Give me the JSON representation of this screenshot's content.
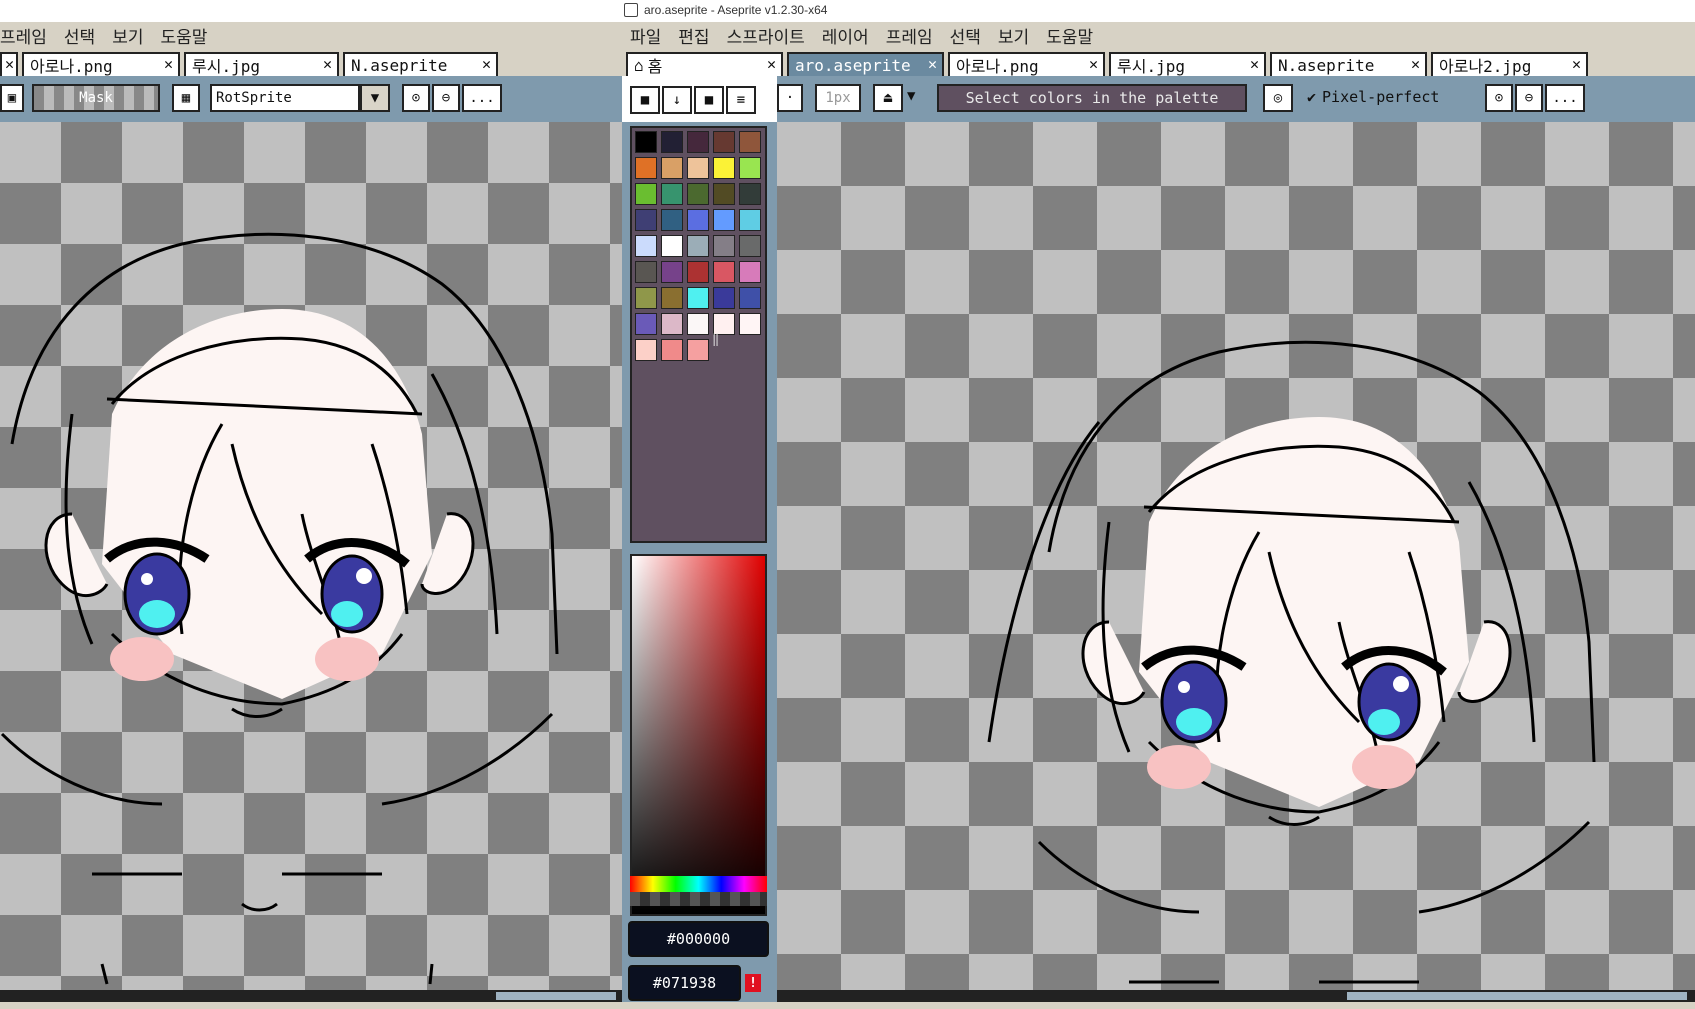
{
  "window": {
    "title": "aro.aseprite - Aseprite v1.2.30-x64"
  },
  "left_window": {
    "menu": [
      "프레임",
      "선택",
      "보기",
      "도움말"
    ],
    "tabs": [
      {
        "label": "아로나.png"
      },
      {
        "label": "루시.jpg"
      },
      {
        "label": "N.aseprite"
      }
    ],
    "toolbar": {
      "mask_label": "Mask",
      "algorithm": "RotSprite",
      "more_label": "..."
    }
  },
  "right_window": {
    "menu": [
      "파일",
      "편집",
      "스프라이트",
      "레이어",
      "프레임",
      "선택",
      "보기",
      "도움말"
    ],
    "tabs": [
      {
        "label": "홈"
      },
      {
        "label": "aro.aseprite"
      },
      {
        "label": "아로나.png"
      },
      {
        "label": "루시.jpg"
      },
      {
        "label": "N.aseprite"
      },
      {
        "label": "아로나2.jpg"
      }
    ],
    "toolbar": {
      "brush_size": "1px",
      "status_message": "Select colors in the palette",
      "pixel_perfect_label": "Pixel-perfect",
      "pixel_perfect_checked": true,
      "more_label": "..."
    }
  },
  "palette": {
    "colors": [
      "#000000",
      "#222034",
      "#45283c",
      "#663931",
      "#8f563b",
      "#df7126",
      "#d9a066",
      "#eec39a",
      "#fbf236",
      "#99e550",
      "#6abe30",
      "#37946e",
      "#4b692f",
      "#524b24",
      "#323c39",
      "#3f3f74",
      "#306082",
      "#5b6ee1",
      "#639bff",
      "#5fcde4",
      "#cbdbfc",
      "#ffffff",
      "#9badb7",
      "#847e87",
      "#696a6a",
      "#595652",
      "#76428a",
      "#ac3232",
      "#d95763",
      "#d77bba",
      "#8f974a",
      "#8a6f30",
      "#4ff0f0",
      "#3a3a9a",
      "#3f50a8",
      "#6a5ab8",
      "#dcb8c8",
      "#fbf7f7",
      "#fff0f0",
      "#fff5f5",
      "#fcd0c8",
      "#f08a8a",
      "#f5a0a0"
    ],
    "foreground_hex": "#000000",
    "background_hex": "#071938"
  },
  "colors": {
    "accent": "#7f9aad",
    "tab_active": "#6b8aa0",
    "menubar": "#d7d2c5"
  }
}
